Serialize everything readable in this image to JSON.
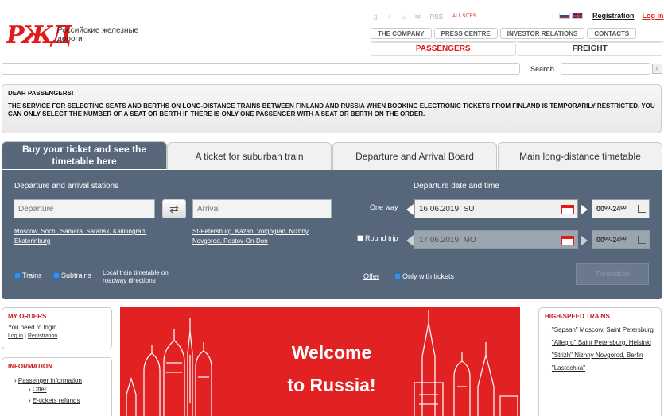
{
  "header": {
    "logo_mark": "РЖД",
    "logo_text": "Российские железные дороги",
    "top_icons": [
      "phone-icon",
      "sitemap-icon",
      "home-icon",
      "mail-icon",
      "rss-icon"
    ],
    "all_sites": "ALL SITES",
    "registration": "Registration",
    "login": "Log in",
    "main_nav": [
      "THE COMPANY",
      "PRESS CENTRE",
      "INVESTOR RELATIONS",
      "CONTACTS"
    ],
    "sections": [
      "PASSENGERS",
      "FREIGHT"
    ],
    "search_label": "Search",
    "search_value": ""
  },
  "notice": {
    "title": "DEAR PASSENGERS!",
    "body": "THE SERVICE FOR SELECTING SEATS AND BERTHS ON LONG-DISTANCE TRAINS BETWEEN FINLAND AND RUSSIA WHEN BOOKING ELECTRONIC TICKETS FROM FINLAND IS TEMPORARILY RESTRICTED. YOU CAN ONLY SELECT THE NUMBER OF A SEAT OR BERTH IF THERE IS ONLY ONE PASSENGER WITH A SEAT OR BERTH ON THE ORDER."
  },
  "tabs": [
    "Buy your ticket and see the timetable here",
    "A ticket for suburban train",
    "Departure and Arrival Board",
    "Main long-distance timetable"
  ],
  "widget": {
    "stations_label": "Departure and arrival stations",
    "departure_placeholder": "Departure",
    "arrival_placeholder": "Arrival",
    "departure_links": "Moscow, Sochi, Samara, Saransk, Kaliningrad, Ekaterinburg",
    "arrival_links": "St-Petersburg, Kazan, Volgograd, Nizhny Novgorod, Rostov-On-Don",
    "date_label": "Departure date and time",
    "one_way": "One way",
    "one_way_date": "16.06.2019, SU",
    "round_trip": "Round trip",
    "round_trip_date": "17.06.2019, MO",
    "time_range_1": "00⁰⁰-24⁰⁰",
    "time_range_2": "00⁰⁰-24⁰⁰",
    "trains": "Trains",
    "subtrains": "Subtrains",
    "local_timetable": "Local train timetable on roadway directions",
    "offer": "Offer",
    "only_with_tickets": "Only with tickets",
    "timetable_btn": "Timetable"
  },
  "my_orders": {
    "title": "MY ORDERS",
    "text": "You need to login",
    "login_link": "Log in",
    "sep": "|",
    "registration_link": "Registration"
  },
  "information": {
    "title": "INFORMATION",
    "items": [
      "Passenger information",
      "Offer",
      "E-tickets refunds"
    ]
  },
  "banner": {
    "line1": "Welcome",
    "line2": "to Russia!"
  },
  "high_speed": {
    "title": "HIGH-SPEED TRAINS",
    "items": [
      "\"Sapsan\" Moscow, Saint Petersburg",
      "\"Allegro\" Saint Petersburg, Helsinki",
      "\"Strizh\" Nizhny Novgorod, Berlin",
      "\"Lastochka\""
    ]
  },
  "colors": {
    "brand_red": "#e21a1a",
    "widget_blue": "#56677b",
    "banner_red": "#e22222"
  }
}
